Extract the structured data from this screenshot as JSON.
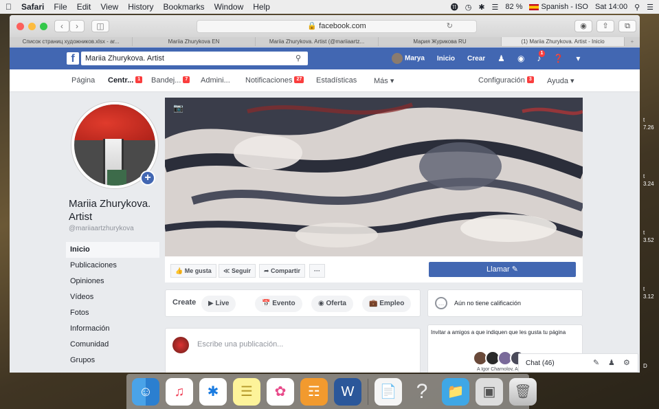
{
  "menubar": {
    "apple": "",
    "app": "Safari",
    "items": [
      "File",
      "Edit",
      "View",
      "History",
      "Bookmarks",
      "Window",
      "Help"
    ],
    "battery": "82 %",
    "input_source": "Spanish - ISO",
    "clock": "Sat 14:00"
  },
  "browser": {
    "url": "facebook.com",
    "tabs": [
      "Список страниц художников.xlsx - ar...",
      "Mariia Zhurykova EN",
      "Mariia Zhurykova. Artist (@mariiaartz...",
      "Мария Журикова RU",
      "(1) Mariia Zhurykova. Artist - Inicio"
    ],
    "active_tab": 4
  },
  "fb": {
    "logo": "f",
    "search_value": "Mariia Zhurykova. Artist",
    "user": "Marya",
    "nav": [
      "Inicio",
      "Crear"
    ],
    "notif_badge": "1"
  },
  "pagenav": {
    "pagina": "Página",
    "centro": "Centr...",
    "centro_badge": "1",
    "bandeja": "Bandej...",
    "bandeja_badge": "7",
    "admin": "Admini...",
    "notif": "Notificaciones",
    "notif_badge": "27",
    "stats": "Estadísticas",
    "more": "Más ▾",
    "config": "Configuración",
    "config_badge": "3",
    "help": "Ayuda ▾"
  },
  "profile": {
    "name": "Mariia Zhurykova. Artist",
    "username": "@mariiaartzhurykova"
  },
  "leftnav": [
    "Inicio",
    "Publicaciones",
    "Opiniones",
    "Vídeos",
    "Fotos",
    "Información",
    "Comunidad",
    "Grupos"
  ],
  "actions": {
    "like": "Me gusta",
    "follow": "Seguir",
    "share": "Compartir",
    "more": "···",
    "call": "Llamar"
  },
  "create": {
    "title": "Create",
    "items": [
      "Live",
      "Evento",
      "Oferta",
      "Empleo"
    ]
  },
  "rating": "Aún no tiene calificación",
  "post_placeholder": "Escribe una publicación...",
  "invite": "Invitar a amigos a que indiquen que les gusta tu página",
  "friends_text": "A Igor Charnolov, Anna G...",
  "chat": "Chat (46)",
  "desktop_labels": [
    "t",
    "7.26",
    "t",
    "3.24",
    "t",
    "3.52",
    "t",
    "3.12",
    "D"
  ]
}
